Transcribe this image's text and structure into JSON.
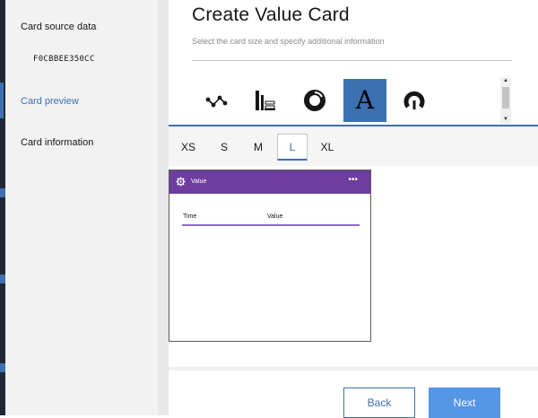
{
  "sidebar": {
    "items": [
      {
        "label": "Card source data",
        "sub": "F0CBBEE350CC"
      },
      {
        "label": "Card preview",
        "active": true
      },
      {
        "label": "Card information"
      }
    ]
  },
  "header": {
    "title": "Create Value Card",
    "subtitle": "Select the card size and specify additional information"
  },
  "card_types": [
    {
      "icon": "line-chart-icon"
    },
    {
      "icon": "table-list-icon"
    },
    {
      "icon": "donut-chart-icon"
    },
    {
      "icon": "text-value-icon",
      "letter": "A",
      "selected": true
    },
    {
      "icon": "gauge-icon"
    }
  ],
  "sizes": [
    {
      "label": "XS"
    },
    {
      "label": "S"
    },
    {
      "label": "M"
    },
    {
      "label": "L",
      "selected": true
    },
    {
      "label": "XL"
    }
  ],
  "preview": {
    "title": "Value",
    "more": "•••",
    "columns": [
      "Time",
      "Value"
    ]
  },
  "footer": {
    "back_label": "Back",
    "next_label": "Next"
  },
  "colors": {
    "accent": "#3d70b2",
    "card_header": "#6e3d9f",
    "next_button": "#5596e6"
  }
}
